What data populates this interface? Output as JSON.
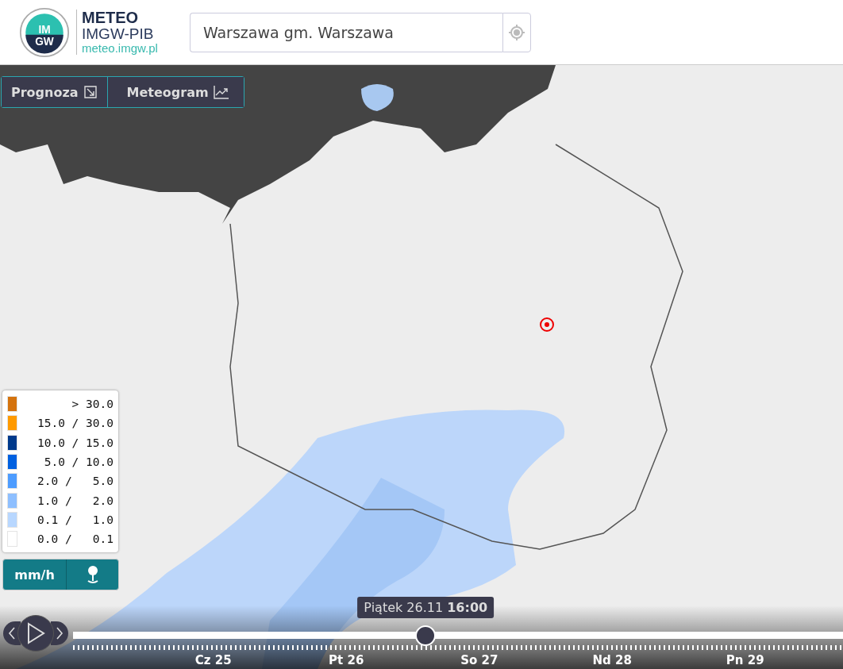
{
  "header": {
    "logo_text": "IM GW",
    "brand": "METEO",
    "org": "IMGW-PIB",
    "site": "meteo.imgw.pl",
    "search": {
      "value": "Warszawa gm. Warszawa"
    }
  },
  "map_buttons": [
    {
      "label": "Prognoza",
      "kind": "forecast"
    },
    {
      "label": "Meteogram",
      "kind": "chart"
    }
  ],
  "legend": {
    "items": [
      {
        "label": "> 30.0",
        "color": "#d4730e"
      },
      {
        "label": "15.0 / 30.0",
        "color": "#ff9a00"
      },
      {
        "label": "10.0 / 15.0",
        "color": "#003a8c"
      },
      {
        "label": "5.0 / 10.0",
        "color": "#0060e0"
      },
      {
        "label": "2.0 /   5.0",
        "color": "#4d9cff"
      },
      {
        "label": "1.0 /   2.0",
        "color": "#8ebfff"
      },
      {
        "label": "0.1 /   1.0",
        "color": "#b8d7ff"
      },
      {
        "label": "0.0 /   0.1",
        "color": "#ffffff"
      }
    ],
    "unit": "mm/h"
  },
  "timeline": {
    "tooltip": "Piątek 26.11 **16:00**",
    "level": 0.458,
    "days": [
      "Cz 25",
      "Pt 26",
      "So 27",
      "Nd 28",
      "Pn 29"
    ]
  }
}
